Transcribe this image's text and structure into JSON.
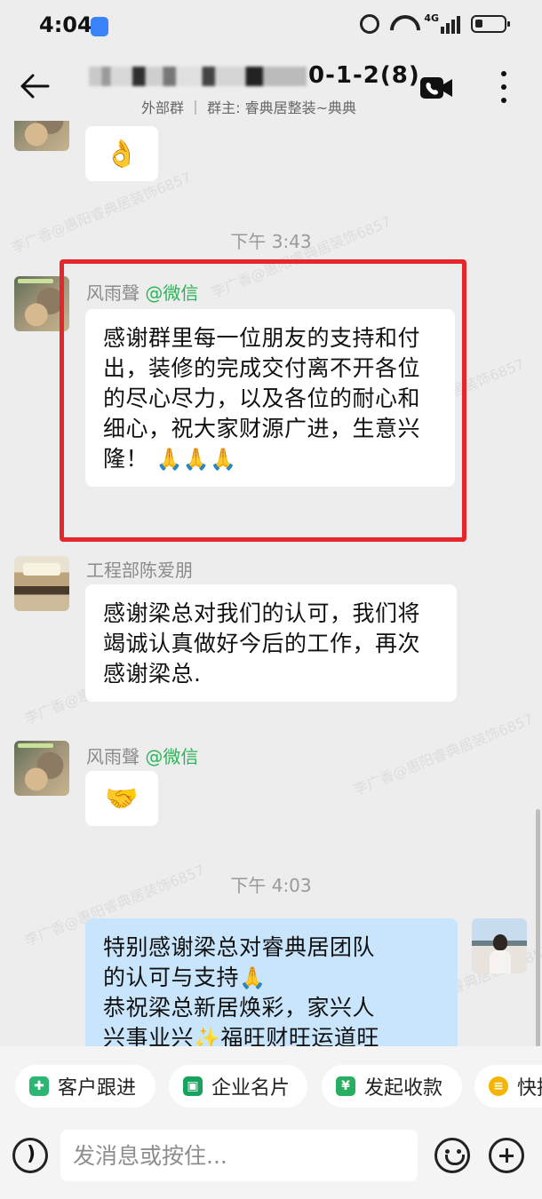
{
  "status_bar": {
    "time": "4:04",
    "network": "4G"
  },
  "header": {
    "title_visible": "0-1-2",
    "member_count": "(8)",
    "subtitle": "外部群 ｜ 群主: 睿典居整装~典典"
  },
  "watermark_text": "李广香@惠阳睿典居装饰6857",
  "messages": [
    {
      "id": "m0",
      "side": "left",
      "avatar": "cat-photo",
      "content": "👌",
      "kind": "emoji"
    },
    {
      "id": "ts1",
      "kind": "timestamp",
      "text": "下午 3:43"
    },
    {
      "id": "m1",
      "side": "left",
      "avatar": "cat-photo",
      "sender": "风雨聲",
      "sender_tag": "@微信",
      "text": "感谢群里每一位朋友的支持和付出，装修的完成交付离不开各位的尽心尽力，以及各位的耐心和细心，祝大家财源广进，生意兴隆！",
      "emojis": "🙏🙏🙏",
      "highlighted": true
    },
    {
      "id": "m2",
      "side": "left",
      "avatar": "room-photo",
      "sender": "工程部陈爱朋",
      "text": "感谢梁总对我们的认可，我们将竭诚认真做好今后的工作，再次感谢梁总."
    },
    {
      "id": "m3",
      "side": "left",
      "avatar": "cat-photo",
      "sender": "风雨聲",
      "sender_tag": "@微信",
      "content": "🤝",
      "kind": "emoji"
    },
    {
      "id": "ts2",
      "kind": "timestamp",
      "text": "下午 4:03"
    },
    {
      "id": "m4",
      "side": "right",
      "avatar": "woman-photo",
      "line1": "特别感谢梁总对睿典居团队",
      "line2": "的认可与支持",
      "line3": "恭祝梁总新居焕彩，家兴人",
      "line4": "兴事业兴",
      "line4b": "福旺财旺运道旺",
      "emoji_pray": "🙏",
      "emoji_spark": "✨"
    }
  ],
  "quick_actions": [
    {
      "label": "客户跟进",
      "icon": "customer-follow-icon",
      "color": "#2bb673"
    },
    {
      "label": "企业名片",
      "icon": "business-card-icon",
      "color": "#19a15f"
    },
    {
      "label": "发起收款",
      "icon": "payment-icon",
      "color": "#27ae60"
    },
    {
      "label": "快捷",
      "icon": "quick-reply-icon",
      "color": "#f4b400"
    }
  ],
  "input": {
    "placeholder": "发消息或按住..."
  }
}
